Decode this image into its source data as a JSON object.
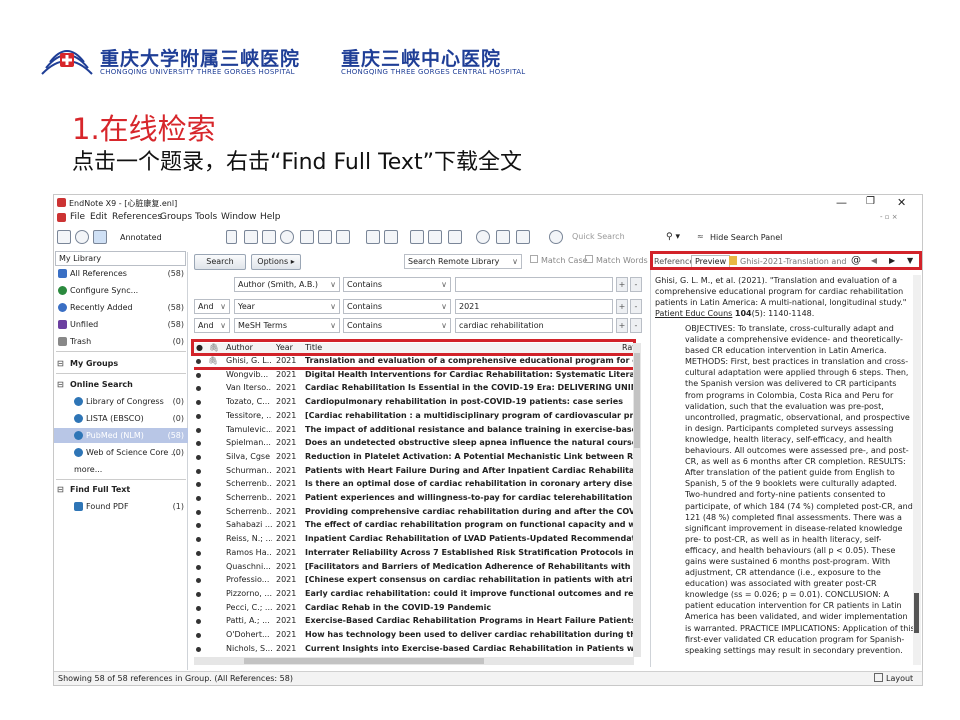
{
  "slide": {
    "org1": "重庆大学附属三峡医院",
    "org1_en": "CHONGQING UNIVERSITY THREE GORGES HOSPITAL",
    "org2": "重庆三峡中心医院",
    "org2_en": "CHONGQING THREE GORGES CENTRAL HOSPITAL",
    "heading": "1.在线检索",
    "subheading": "点击一个题录，右击“Find Full Text”下载全文"
  },
  "window": {
    "title": "EndNote X9 - [心脏康复.enl]",
    "menu": [
      "File",
      "Edit",
      "References",
      "Groups",
      "Tools",
      "Window",
      "Help"
    ],
    "style_label": "Annotated",
    "quick_search_placeholder": "Quick Search",
    "hide_panel": "Hide Search Panel",
    "win_min": "—",
    "win_max": "❐",
    "win_close": "✕"
  },
  "sidebar": {
    "header": "My Library",
    "items": [
      {
        "label": "All References",
        "count": "(58)",
        "kind": "item",
        "color": "#3a6fc4"
      },
      {
        "label": "Configure Sync...",
        "count": "",
        "kind": "item",
        "color": "#2b8a3e"
      },
      {
        "label": "Recently Added",
        "count": "(58)",
        "kind": "item",
        "color": "#3a6fc4"
      },
      {
        "label": "Unfiled",
        "count": "(58)",
        "kind": "item",
        "color": "#6b3fa0"
      },
      {
        "label": "Trash",
        "count": "(0)",
        "kind": "item",
        "color": "#777777"
      },
      {
        "label": "My Groups",
        "count": "",
        "kind": "group",
        "color": ""
      },
      {
        "label": "Online Search",
        "count": "",
        "kind": "group",
        "color": ""
      },
      {
        "label": "Library of Congress",
        "count": "(0)",
        "kind": "sub",
        "color": "#2e75b6"
      },
      {
        "label": "LISTA (EBSCO)",
        "count": "(0)",
        "kind": "sub",
        "color": "#2e75b6"
      },
      {
        "label": "PubMed (NLM)",
        "count": "(58)",
        "kind": "sub-selected",
        "color": "#2e75b6"
      },
      {
        "label": "Web of Science Core ...",
        "count": "(0)",
        "kind": "sub",
        "color": "#2e75b6"
      },
      {
        "label": "more...",
        "count": "",
        "kind": "more",
        "color": ""
      },
      {
        "label": "Find Full Text",
        "count": "",
        "kind": "group",
        "color": ""
      },
      {
        "label": "Found PDF",
        "count": "(1)",
        "kind": "sub",
        "color": "#2e75b6"
      }
    ]
  },
  "search": {
    "search_btn": "Search",
    "options_btn": "Options ▸",
    "remote": "Search Remote Library",
    "match_case": "Match Case",
    "match_words": "Match Words",
    "rows": [
      {
        "bool": "",
        "field": "Author (Smith, A.B.)",
        "op": "Contains",
        "value": ""
      },
      {
        "bool": "And",
        "field": "Year",
        "op": "Contains",
        "value": "2021"
      },
      {
        "bool": "And",
        "field": "MeSH Terms",
        "op": "Contains",
        "value": "cardiac rehabilitation"
      }
    ]
  },
  "list": {
    "columns": {
      "author": "Author",
      "year": "Year",
      "title": "Title",
      "rating": "Rat"
    },
    "rows": [
      {
        "author": "Ghisi, G. L...",
        "year": "2021",
        "title": "Translation and evaluation of a comprehensive educational program for cardi..."
      },
      {
        "author": "Wongvib...",
        "year": "2021",
        "title": "Digital Health Interventions for Cardiac Rehabilitation: Systematic Literature R..."
      },
      {
        "author": "Van Iterso...",
        "year": "2021",
        "title": "Cardiac Rehabilitation Is Essential in the COVID-19 Era: DELIVERING UNINTER..."
      },
      {
        "author": "Tozato, C...",
        "year": "2021",
        "title": "Cardiopulmonary rehabilitation in post-COVID-19 patients: case series"
      },
      {
        "author": "Tessitore, ...",
        "year": "2021",
        "title": "[Cardiac rehabilitation : a multidisciplinary program of cardiovascular preventi..."
      },
      {
        "author": "Tamulevic...",
        "year": "2021",
        "title": "The impact of additional resistance and balance training in exercise-based car..."
      },
      {
        "author": "Spielman...",
        "year": "2021",
        "title": "Does an undetected obstructive sleep apnea influence the natural course and ..."
      },
      {
        "author": "Silva, Cgse",
        "year": "2021",
        "title": "Reduction in Platelet Activation: A Potential Mechanistic Link between Regula..."
      },
      {
        "author": "Schurman...",
        "year": "2021",
        "title": "Patients with Heart Failure During and After Inpatient Cardiac Rehabilitation"
      },
      {
        "author": "Scherrenb...",
        "year": "2021",
        "title": "Is there an optimal dose of cardiac rehabilitation in coronary artery disease pa..."
      },
      {
        "author": "Scherrenb...",
        "year": "2021",
        "title": "Patient experiences and willingness-to-pay for cardiac telerehabilitation durin..."
      },
      {
        "author": "Scherrenb...",
        "year": "2021",
        "title": "Providing comprehensive cardiac rehabilitation during and after the COVID-19..."
      },
      {
        "author": "Sahabazi ...",
        "year": "2021",
        "title": "The effect of cardiac rehabilitation program on functional capacity and waist t..."
      },
      {
        "author": "Reiss, N.; ...",
        "year": "2021",
        "title": "Inpatient Cardiac Rehabilitation of LVAD Patients-Updated Recommendations ..."
      },
      {
        "author": "Ramos Ha...",
        "year": "2021",
        "title": "Interrater Reliability Across 7 Established Risk Stratification Protocols in Cardi..."
      },
      {
        "author": "Quaschni...",
        "year": "2021",
        "title": "[Facilitators and Barriers of Medication Adherence of Rehabilitants with Cardio..."
      },
      {
        "author": "Professio...",
        "year": "2021",
        "title": "[Chinese expert consensus on cardiac rehabilitation in patients with atrial fibri..."
      },
      {
        "author": "Pizzorno, ...",
        "year": "2021",
        "title": "Early cardiac rehabilitation: could it improve functional outcomes and reduce l..."
      },
      {
        "author": "Pecci, C.; ...",
        "year": "2021",
        "title": "Cardiac Rehab in the COVID-19 Pandemic"
      },
      {
        "author": "Patti, A.; ...",
        "year": "2021",
        "title": "Exercise-Based Cardiac Rehabilitation Programs in Heart Failure Patients"
      },
      {
        "author": "O'Dohert...",
        "year": "2021",
        "title": "How has technology been used to deliver cardiac rehabilitation during the CO..."
      },
      {
        "author": "Nichols, S...",
        "year": "2021",
        "title": "Current Insights into Exercise-based Cardiac Rehabilitation in Patients with Co..."
      }
    ]
  },
  "reference": {
    "tab1": "Reference",
    "tab2": "Preview",
    "pdf_tab": "Ghisi-2021-Translation and ev",
    "citation_a": "Ghisi, G. L. M., et al. (2021). \"Translation and evaluation of a comprehensive educational program for cardiac rehabilitation patients in Latin America: A multi-national, longitudinal study.\"",
    "journal": "Patient Educ Couns",
    "volume": "104",
    "pages": "(5): 1140-1148.",
    "abstract": "OBJECTIVES: To translate, cross-culturally adapt and validate a comprehensive evidence- and theoretically-based CR education intervention in Latin America. METHODS: First, best practices in translation and cross-cultural adaptation were applied through 6 steps. Then, the Spanish version was delivered to CR participants from programs in Colombia, Costa Rica and Peru for validation, such that the evaluation was pre-post, uncontrolled, pragmatic, observational, and prospective in design. Participants completed surveys assessing knowledge, health literacy, self-efficacy, and health behaviours. All outcomes were assessed pre-, and post-CR, as well as 6 months after CR completion. RESULTS: After translation of the patient guide from English to Spanish, 5 of the 9 booklets were culturally adapted. Two-hundred and forty-nine patients consented to participate, of which 184 (74 %) completed post-CR, and 121 (48 %) completed final assessments. There was a significant improvement in disease-related knowledge pre- to post-CR, as well as in health literacy, self-efficacy, and health behaviours (all p < 0.05). These gains were sustained 6 months post-program. With adjustment, CR attendance (i.e., exposure to the education) was associated with greater post-CR knowledge (ss = 0.026; p = 0.01). CONCLUSION: A patient education intervention for CR patients in Latin America has been validated, and wider implementation is warranted. PRACTICE IMPLICATIONS: Application of this first-ever validated CR education program for Spanish-speaking settings may result in secondary prevention."
  },
  "status": {
    "text": "Showing 58 of 58 references in Group. (All References: 58)",
    "layout": "Layout"
  }
}
